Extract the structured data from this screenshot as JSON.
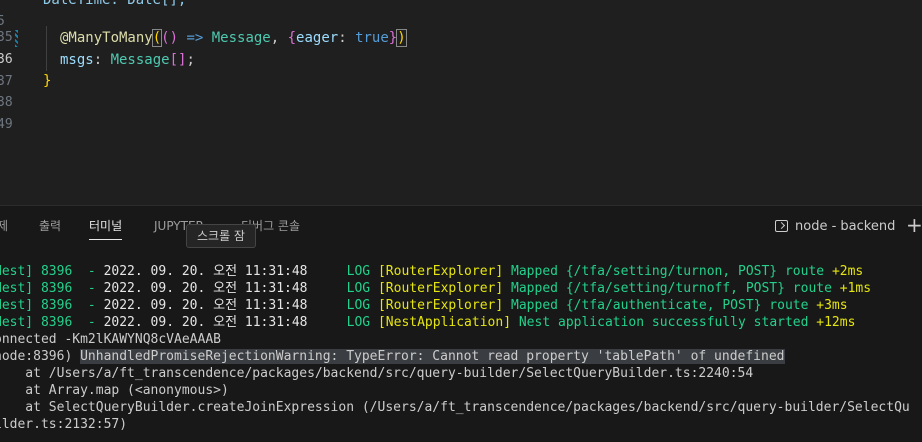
{
  "editor": {
    "lines": [
      {
        "num": "5",
        "text": "DateTime: Date[];"
      },
      {
        "num": "35"
      },
      {
        "num": "36",
        "decorator": "@ManyToMany",
        "open_paren": "(",
        "arrow_open": "()",
        "arrow": " => ",
        "type": "Message",
        "comma": ", ",
        "obj_open": "{",
        "key": "eager",
        "colon": ": ",
        "value": "true",
        "obj_close": "}",
        "close_paren": ")"
      },
      {
        "num": "37",
        "prop": "msgs",
        "colon": ": ",
        "type": "Message",
        "brackets": "[]",
        "semi": ";"
      },
      {
        "num": "38",
        "brace": "}"
      },
      {
        "num": "49"
      }
    ]
  },
  "panel": {
    "tabs": [
      {
        "label": "제"
      },
      {
        "label": "출력"
      },
      {
        "label": "터미널"
      },
      {
        "label": "JUPYTER"
      },
      {
        "label": "디버그 콘솔"
      }
    ],
    "terminal_selector": "node - backend",
    "plus": "+"
  },
  "terminal": {
    "log_rows": [
      {
        "prefix": "Nest] 8396  - ",
        "time": "2022. 09. 20. 오전 11:31:48",
        "level": "LOG",
        "context": "[RouterExplorer]",
        "message": "Mapped {/tfa/setting/turnon, POST} route",
        "ms": "+2ms"
      },
      {
        "prefix": "Nest] 8396  - ",
        "time": "2022. 09. 20. 오전 11:31:48",
        "level": "LOG",
        "context": "[RouterExplorer]",
        "message": "Mapped {/tfa/setting/turnoff, POST} route",
        "ms": "+1ms"
      },
      {
        "prefix": "Nest] 8396  - ",
        "time": "2022. 09. 20. 오전 11:31:48",
        "level": "LOG",
        "context": "[RouterExplorer]",
        "message": "Mapped {/tfa/authenticate, POST} route",
        "ms": "+3ms"
      },
      {
        "prefix": "Nest] 8396  - ",
        "time": "2022. 09. 20. 오전 11:31:48",
        "level": "LOG",
        "context": "[NestApplication]",
        "message": "Nest application successfully started",
        "ms": "+12ms"
      }
    ],
    "connected": "onnected -Km2lKAWYNQ8cVAeAAAB",
    "error_prefix": "node:8396) ",
    "error_text": "UnhandledPromiseRejectionWarning: TypeError: Cannot read property 'tablePath' of undefined",
    "stack": [
      "    at /Users/a/ft_transcendence/packages/backend/src/query-builder/SelectQueryBuilder.ts:2240:54",
      "    at Array.map (<anonymous>)",
      "    at SelectQueryBuilder.createJoinExpression (/Users/a/ft_transcendence/packages/backend/src/query-builder/SelectQu",
      "ilder.ts:2132:57)"
    ],
    "tooltip": "스크롤 잠"
  },
  "colors": {
    "log_green": "#23d18b",
    "log_yellow": "#e5e510"
  }
}
